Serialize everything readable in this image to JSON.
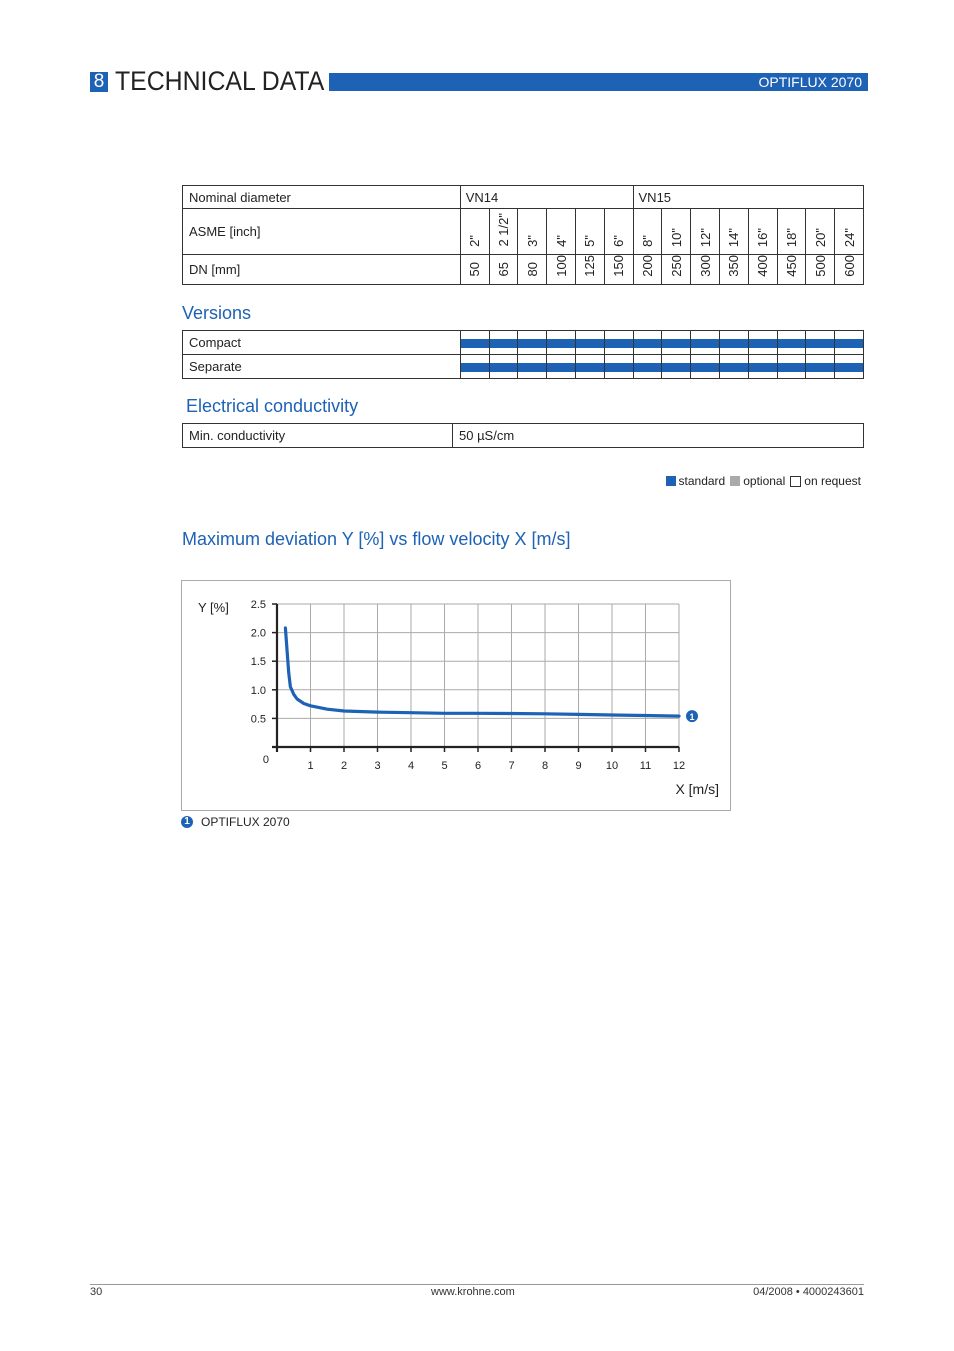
{
  "header": {
    "section_number": "8",
    "title": "TECHNICAL DATA",
    "product": "OPTIFLUX 2070"
  },
  "diameter_table": {
    "row_labels": {
      "nominal": "Nominal diameter",
      "asme": "ASME [inch]",
      "dn": "DN [mm]"
    },
    "groups": [
      {
        "label": "VN14",
        "span": 6
      },
      {
        "label": "VN15",
        "span": 8
      }
    ],
    "asme": [
      "2\"",
      "2 1/2\"",
      "3\"",
      "4\"",
      "5\"",
      "6\"",
      "8\"",
      "10\"",
      "12\"",
      "14\"",
      "16\"",
      "18\"",
      "20\"",
      "24\""
    ],
    "dn": [
      "50",
      "65",
      "80",
      "100",
      "125",
      "150",
      "200",
      "250",
      "300",
      "350",
      "400",
      "450",
      "500",
      "600"
    ]
  },
  "versions": {
    "title": "Versions",
    "rows": [
      {
        "label": "Compact",
        "availability": [
          "standard",
          "standard",
          "standard",
          "standard",
          "standard",
          "standard",
          "standard",
          "standard",
          "standard",
          "standard",
          "standard",
          "standard",
          "standard",
          "standard"
        ]
      },
      {
        "label": "Separate",
        "availability": [
          "standard",
          "standard",
          "standard",
          "standard",
          "standard",
          "standard",
          "standard",
          "standard",
          "standard",
          "standard",
          "standard",
          "standard",
          "standard",
          "standard"
        ]
      }
    ]
  },
  "conductivity": {
    "title": "Electrical conductivity",
    "label": "Min. conductivity",
    "value": "50 µS/cm"
  },
  "legend": {
    "items": [
      {
        "label": "standard",
        "color": "#1d62b4"
      },
      {
        "label": "optional",
        "color": "#aaaaaa"
      },
      {
        "label": "on request",
        "color": "#ffffff"
      }
    ]
  },
  "colors": {
    "accent": "#1d62b4"
  },
  "chart_data": {
    "type": "line",
    "title": "Maximum deviation Y [%] vs flow velocity X [m/s]",
    "xlabel": "X [m/s]",
    "ylabel": "Y [%]",
    "xlim": [
      0,
      12
    ],
    "ylim": [
      0,
      2.5
    ],
    "x_ticks": [
      "1",
      "2",
      "3",
      "4",
      "5",
      "6",
      "7",
      "8",
      "9",
      "10",
      "11",
      "12"
    ],
    "y_ticks": [
      "0.5",
      "1.0",
      "1.5",
      "2.0",
      "2.5"
    ],
    "origin_label": "0",
    "grid": true,
    "series": [
      {
        "name": "OPTIFLUX 2070",
        "marker": "1",
        "x": [
          0.25,
          0.3,
          0.35,
          0.4,
          0.5,
          0.6,
          0.8,
          1,
          1.5,
          2,
          3,
          4,
          5,
          6,
          7,
          8,
          9,
          10,
          11,
          12
        ],
        "y": [
          2.08,
          1.7,
          1.3,
          1.05,
          0.92,
          0.84,
          0.76,
          0.72,
          0.66,
          0.63,
          0.61,
          0.6,
          0.59,
          0.59,
          0.585,
          0.58,
          0.57,
          0.56,
          0.55,
          0.54
        ]
      }
    ]
  },
  "caption": {
    "marker": "1",
    "label": "OPTIFLUX 2070"
  },
  "footer": {
    "page": "30",
    "website": "www.krohne.com",
    "doc_ref": "04/2008 • 4000243601"
  }
}
